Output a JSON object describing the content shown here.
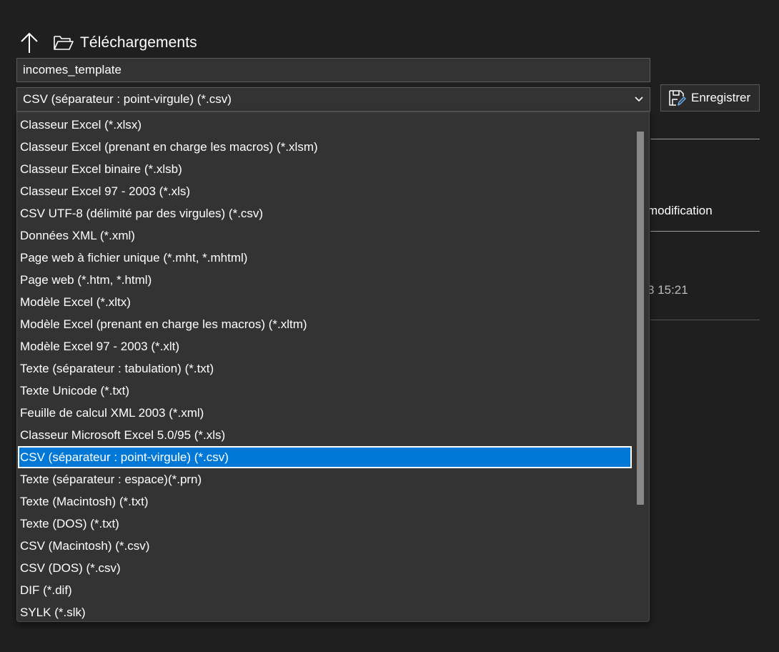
{
  "location": {
    "folder_name": "Téléchargements"
  },
  "filename": {
    "value": "incomes_template"
  },
  "filetype": {
    "selected": "CSV (séparateur : point-virgule) (*.csv)"
  },
  "save_button": {
    "label": "Enregistrer"
  },
  "background_list": {
    "column_header": "modification",
    "row_date": "3 15:21"
  },
  "dropdown": {
    "options": [
      "Classeur Excel (*.xlsx)",
      "Classeur Excel (prenant en charge les macros) (*.xlsm)",
      "Classeur Excel binaire (*.xlsb)",
      "Classeur Excel 97 - 2003 (*.xls)",
      "CSV UTF-8 (délimité par des virgules) (*.csv)",
      "Données XML (*.xml)",
      "Page web à fichier unique (*.mht, *.mhtml)",
      "Page web (*.htm, *.html)",
      "Modèle Excel (*.xltx)",
      "Modèle Excel (prenant en charge les macros) (*.xltm)",
      "Modèle Excel 97 - 2003 (*.xlt)",
      "Texte (séparateur : tabulation) (*.txt)",
      "Texte Unicode (*.txt)",
      "Feuille de calcul XML 2003 (*.xml)",
      "Classeur Microsoft Excel 5.0/95 (*.xls)",
      "CSV (séparateur : point-virgule) (*.csv)",
      "Texte (séparateur : espace)(*.prn)",
      "Texte (Macintosh) (*.txt)",
      "Texte (DOS) (*.txt)",
      "CSV (Macintosh) (*.csv)",
      "CSV (DOS) (*.csv)",
      "DIF (*.dif)",
      "SYLK (*.slk)"
    ],
    "selected_index": 15
  },
  "colors": {
    "background": "#1f1f1f",
    "control": "#333333",
    "accent": "#0078d7"
  }
}
